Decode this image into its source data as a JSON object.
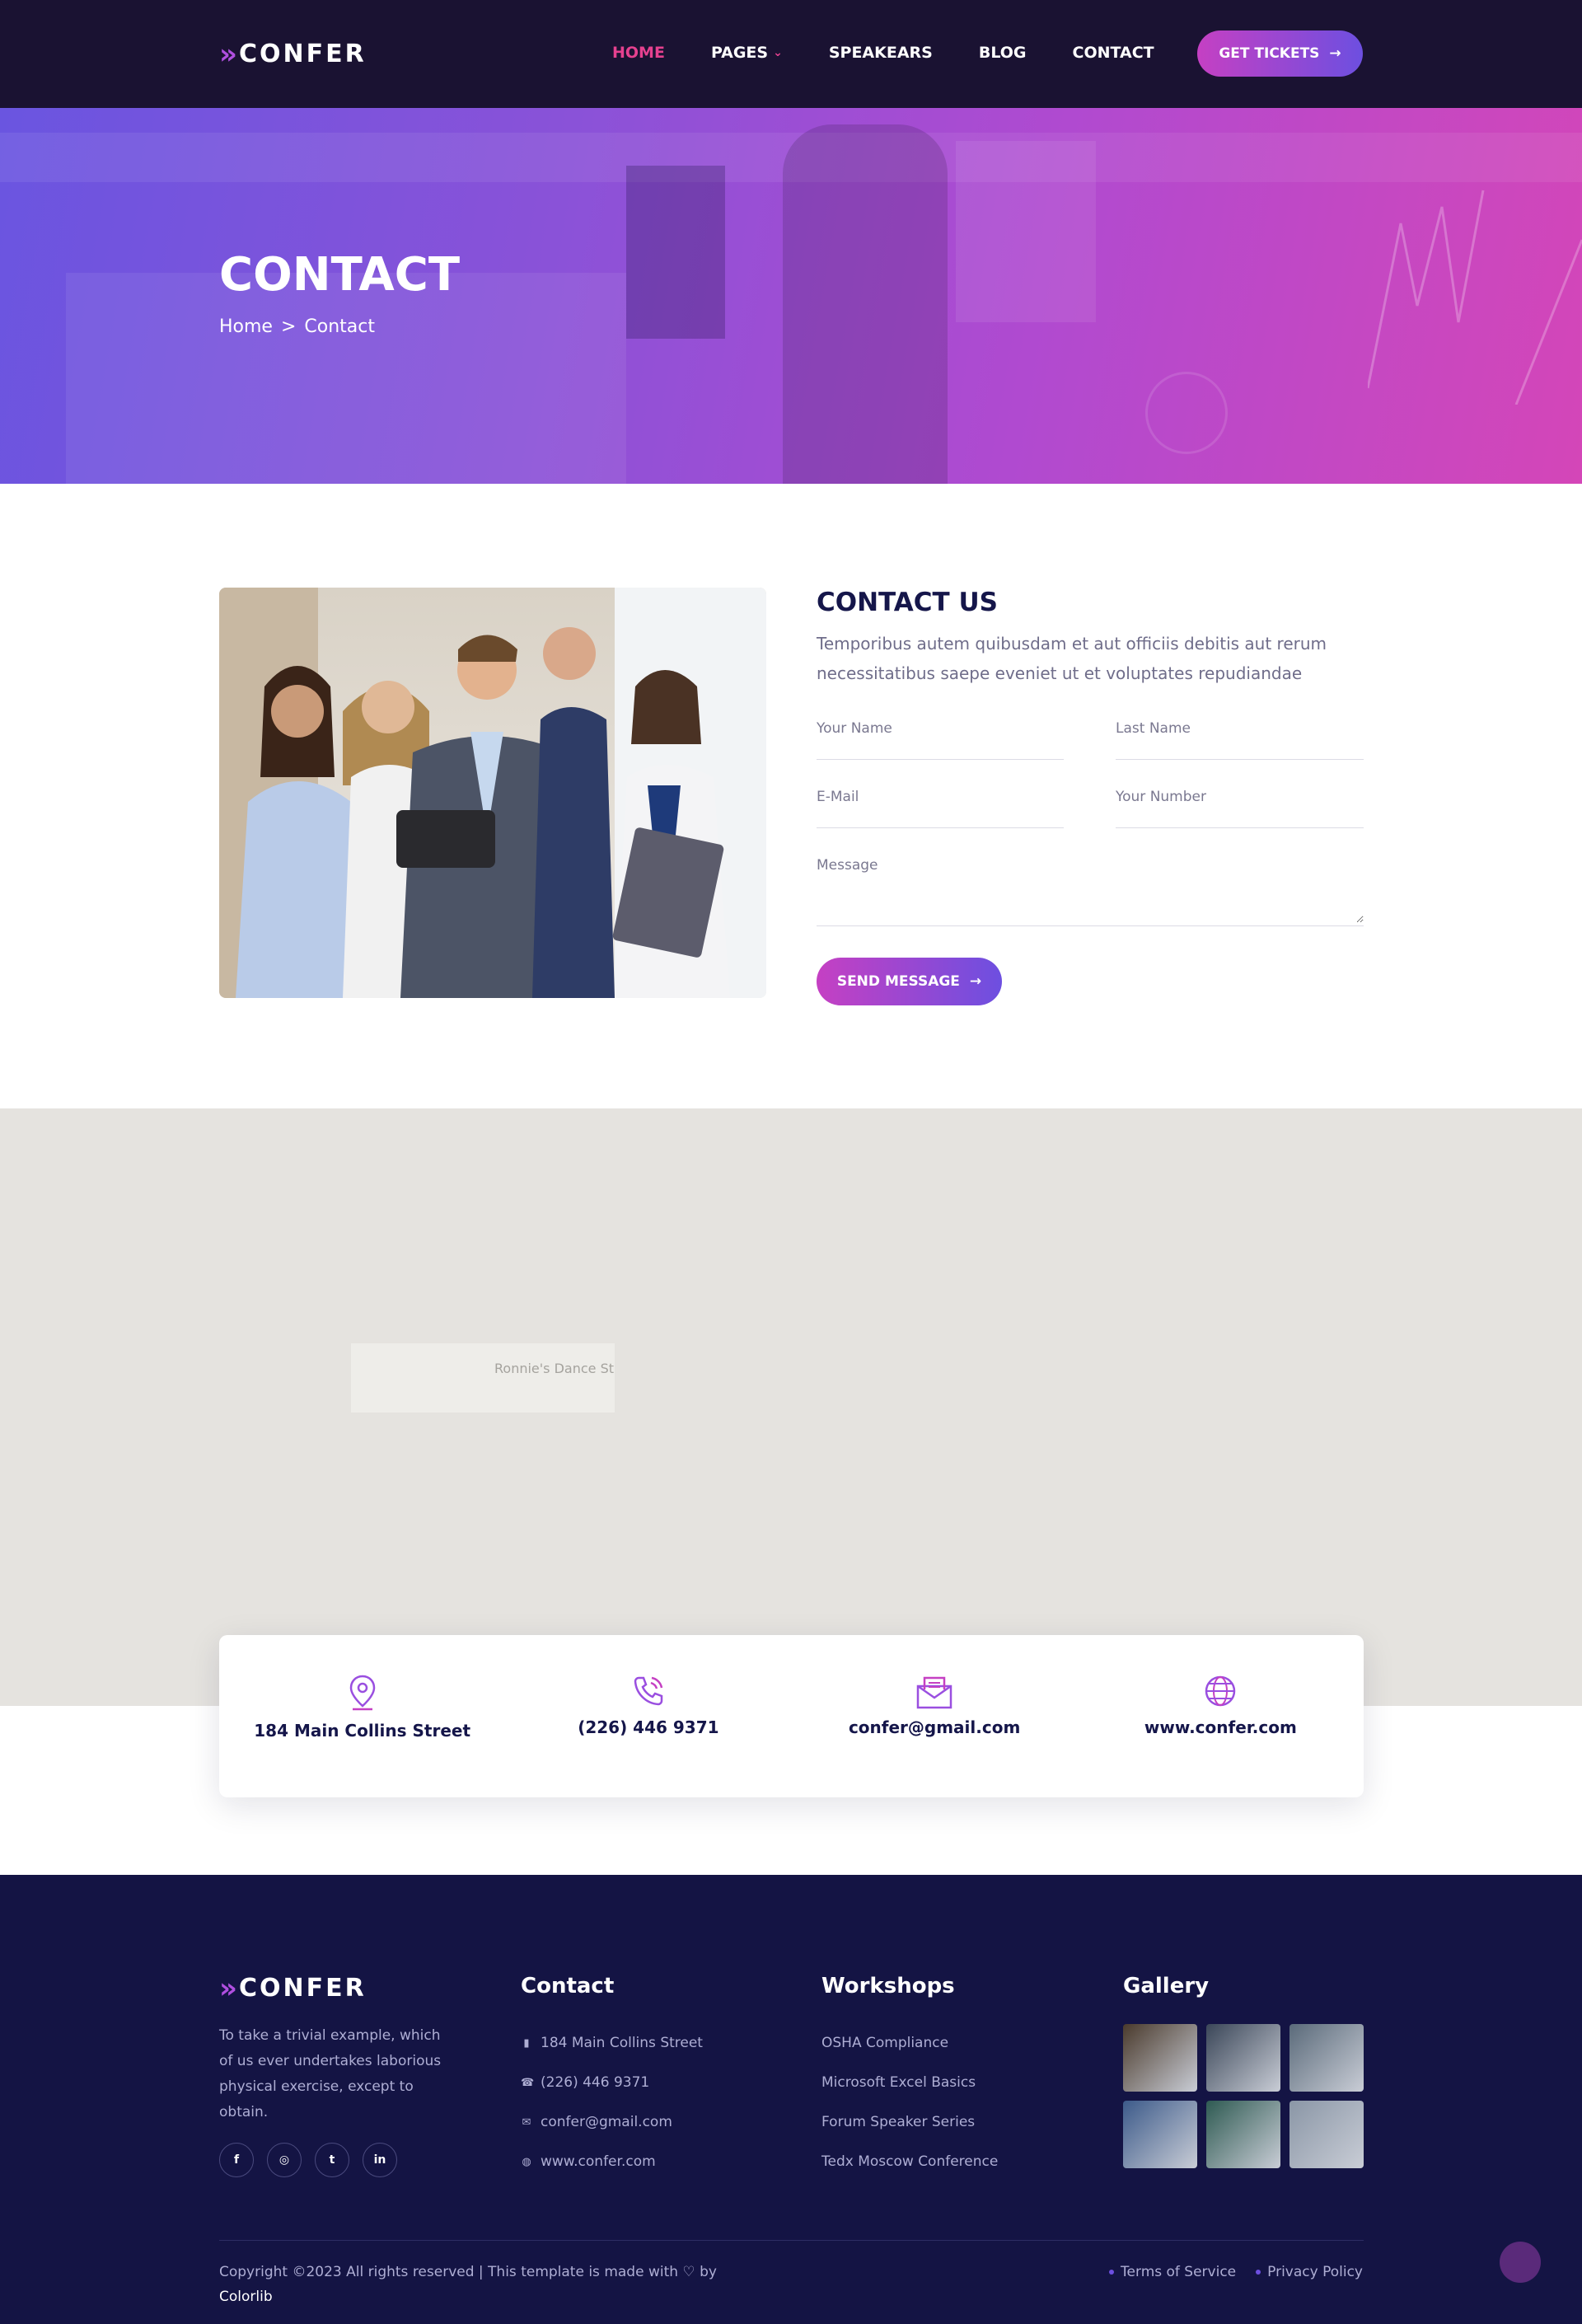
{
  "brand": {
    "name": "CONFER",
    "chevrons": "»"
  },
  "nav": {
    "items": [
      {
        "label": "HOME",
        "active": true
      },
      {
        "label": "PAGES",
        "dropdown": true
      },
      {
        "label": "SPEAKEARS"
      },
      {
        "label": "BLOG"
      },
      {
        "label": "CONTACT"
      }
    ],
    "cta_label": "GET TICKETS",
    "cta_arrow": "→"
  },
  "hero": {
    "title": "CONTACT",
    "breadcrumb": {
      "home": "Home",
      "separator": ">",
      "current": "Contact"
    }
  },
  "contact": {
    "title": "CONTACT US",
    "description": "Temporibus autem quibusdam et aut officiis debitis aut rerum necessitatibus saepe eveniet ut et voluptates repudiandae",
    "form": {
      "first_name_placeholder": "Your Name",
      "last_name_placeholder": "Last Name",
      "email_placeholder": "E-Mail",
      "number_placeholder": "Your Number",
      "message_placeholder": "Message",
      "submit_label": "SEND MESSAGE",
      "submit_arrow": "→"
    }
  },
  "map": {
    "label": "Ronnie's Dance Stu"
  },
  "info": [
    {
      "icon": "location-pin-icon",
      "text": "184 Main Collins Street"
    },
    {
      "icon": "phone-icon",
      "text": "(226) 446 9371"
    },
    {
      "icon": "envelope-icon",
      "text": "confer@gmail.com"
    },
    {
      "icon": "globe-icon",
      "text": "www.confer.com"
    }
  ],
  "footer": {
    "about": "To take a trivial example, which of us ever undertakes laborious physical exercise, except to obtain.",
    "socials": [
      "f",
      "◎",
      "t",
      "in"
    ],
    "contact_title": "Contact",
    "contact_items": [
      {
        "icon": "map-icon",
        "glyph": "▮",
        "text": "184 Main Collins Street"
      },
      {
        "icon": "phone-icon",
        "glyph": "☎",
        "text": "(226) 446 9371"
      },
      {
        "icon": "mail-icon",
        "glyph": "✉",
        "text": "confer@gmail.com"
      },
      {
        "icon": "globe-icon",
        "glyph": "◍",
        "text": "www.confer.com"
      }
    ],
    "workshops_title": "Workshops",
    "workshops": [
      "OSHA Compliance",
      "Microsoft Excel Basics",
      "Forum Speaker Series",
      "Tedx Moscow Conference"
    ],
    "gallery_title": "Gallery",
    "gallery_colors": [
      "#4a3a2c",
      "#3a4658",
      "#5a6a7a",
      "#3c5a8a",
      "#2e5a52",
      "#8a96a6"
    ],
    "copyright": "Copyright ©2023 All rights reserved | This template is made with ♡ by",
    "copyright_brand": "Colorlib",
    "legal": [
      "Terms of Service",
      "Privacy Policy"
    ]
  },
  "colors": {
    "accent_pink": "#e5418f",
    "accent_purple": "#6d4fe0",
    "nav_bg": "#1a1232",
    "footer_bg": "#141444"
  }
}
